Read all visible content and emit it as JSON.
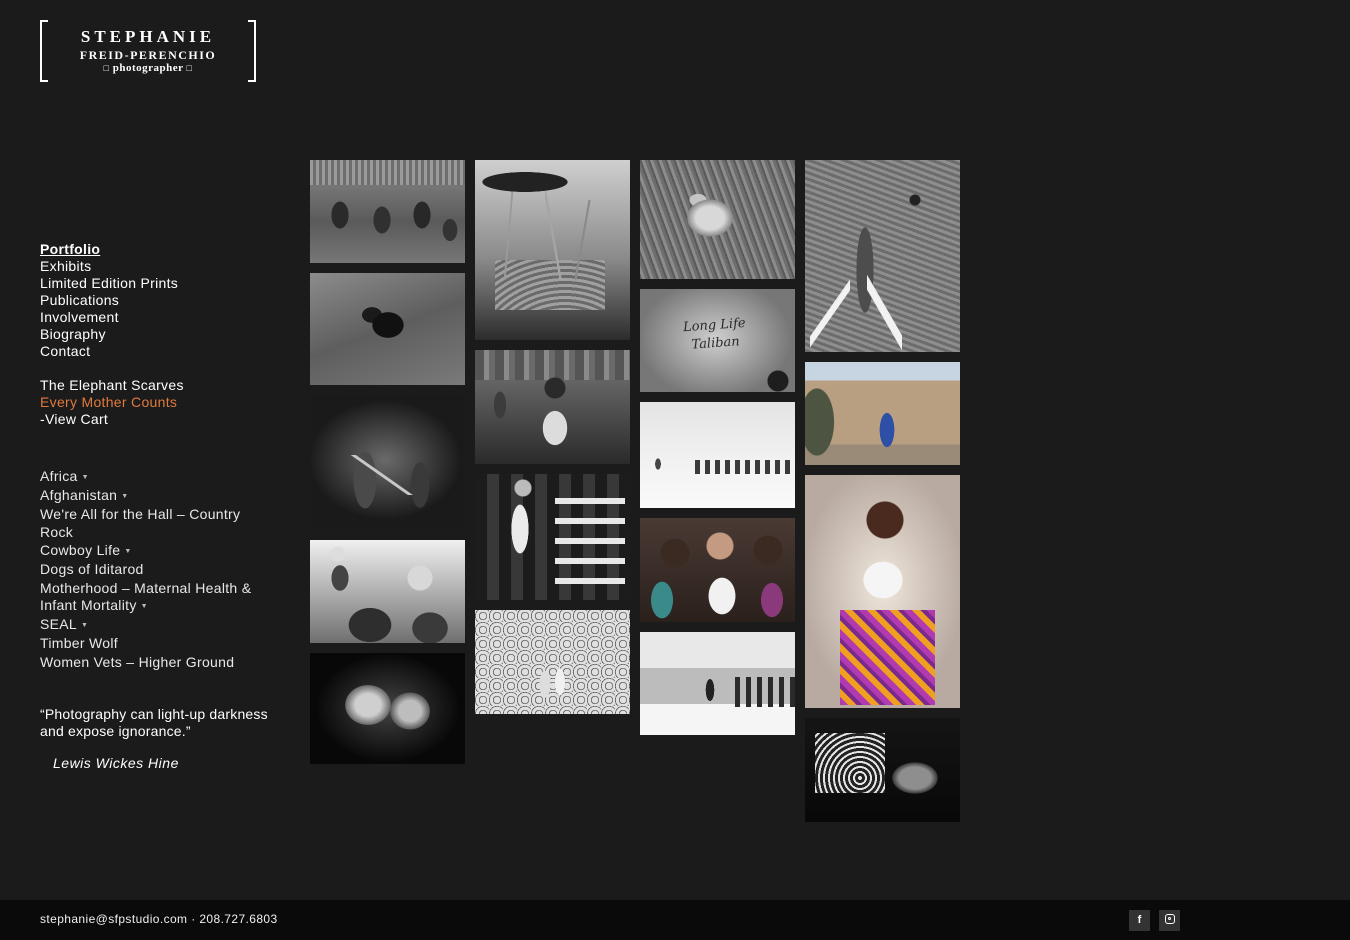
{
  "logo": {
    "line1": "STEPHANIE",
    "line2": "FREID-PERENCHIO",
    "line3": "photographer",
    "square_glyph": "□"
  },
  "main_nav": [
    {
      "label": "Portfolio",
      "active": true
    },
    {
      "label": "Exhibits"
    },
    {
      "label": "Limited Edition Prints"
    },
    {
      "label": "Publications"
    },
    {
      "label": "Involvement"
    },
    {
      "label": "Biography"
    },
    {
      "label": "Contact"
    }
  ],
  "secondary_nav": [
    {
      "label": "The Elephant Scarves"
    },
    {
      "label": "Every Mother Counts",
      "accent_color": "#e07a3c"
    },
    {
      "label": "-View Cart"
    }
  ],
  "galleries": [
    {
      "label": "Africa",
      "has_submenu": true
    },
    {
      "label": "Afghanistan",
      "has_submenu": true
    },
    {
      "label": "We're All for the Hall – Country Rock",
      "has_submenu": false
    },
    {
      "label": "Cowboy Life",
      "has_submenu": true
    },
    {
      "label": "Dogs of Iditarod",
      "has_submenu": false
    },
    {
      "label": "Motherhood – Maternal Health & Infant Mortality",
      "has_submenu": true
    },
    {
      "label": "SEAL",
      "has_submenu": true
    },
    {
      "label": "Timber Wolf",
      "has_submenu": false
    },
    {
      "label": "Women Vets – Higher Ground",
      "has_submenu": false
    }
  ],
  "submenu_caret": "▼",
  "quote": {
    "text": "“Photography can light-up darkness and expose ignorance.”",
    "author": "Lewis Wickes Hine"
  },
  "gallery_thumbnails": [
    {
      "subject": "tribal-warriors",
      "column": 1
    },
    {
      "subject": "gorilla",
      "column": 1
    },
    {
      "subject": "guitarist-concert",
      "column": 1
    },
    {
      "subject": "father-child-crowd",
      "column": 1
    },
    {
      "subject": "wolves",
      "column": 1
    },
    {
      "subject": "giraffes",
      "column": 2
    },
    {
      "subject": "tailor-shop",
      "column": 2
    },
    {
      "subject": "rodeo-cowboy",
      "column": 2
    },
    {
      "subject": "naval-ceremony",
      "column": 2
    },
    {
      "subject": "lion-in-grass",
      "column": 3
    },
    {
      "subject": "long-life-taliban-graffiti",
      "column": 3
    },
    {
      "subject": "cattle-drive-snow",
      "column": 3
    },
    {
      "subject": "girls-group",
      "column": 3
    },
    {
      "subject": "podium-ceremony",
      "column": 3
    },
    {
      "subject": "elephant",
      "column": 4
    },
    {
      "subject": "soldier-street",
      "column": 4
    },
    {
      "subject": "pregnant-woman-portrait",
      "column": 4
    },
    {
      "subject": "dog-with-scarf",
      "column": 4
    }
  ],
  "graffiti_text": "Long Life Taliban",
  "footer": {
    "email": "stephanie@sfpstudio.com",
    "separator": " · ",
    "phone": "208.727.6803",
    "facebook_glyph": "f",
    "facebook_icon": "facebook-icon",
    "instagram_icon": "instagram-icon"
  }
}
